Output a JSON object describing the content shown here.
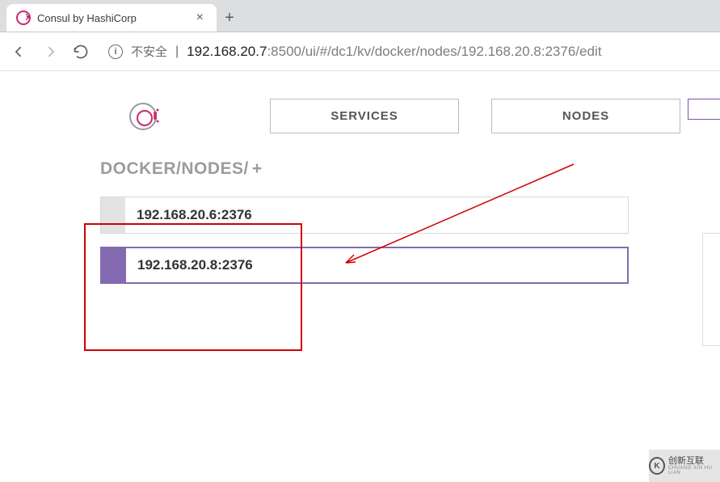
{
  "browser": {
    "tab_title": "Consul by HashiCorp",
    "insecure_label": "不安全",
    "url_host": "192.168.20.7",
    "url_port_path": ":8500/ui/#/dc1/kv/docker/nodes/192.168.20.8:2376/edit"
  },
  "nav": {
    "tabs": [
      {
        "label": "SERVICES"
      },
      {
        "label": "NODES"
      }
    ]
  },
  "breadcrumb": {
    "path": "DOCKER/NODES/",
    "add": "+"
  },
  "kv_items": [
    {
      "label": "192.168.20.6:2376",
      "selected": false
    },
    {
      "label": "192.168.20.8:2376",
      "selected": true
    }
  ],
  "watermark": {
    "brand": "创新互联",
    "sub": "CHUANG XIN HU LIAN"
  }
}
